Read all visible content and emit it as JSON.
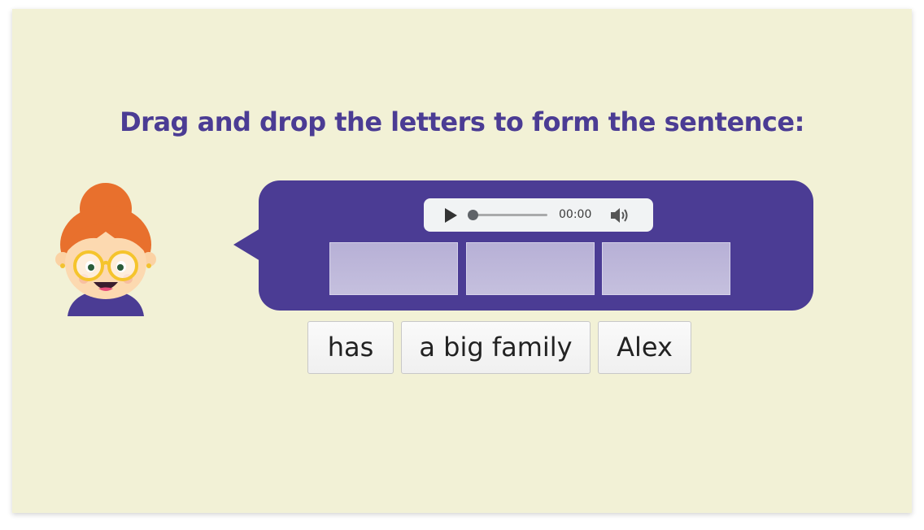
{
  "instruction": "Drag and drop the letters to form the sentence:",
  "audio": {
    "time": "00:00",
    "progress": 0
  },
  "answer_slots": 3,
  "word_tiles": [
    {
      "label": "has"
    },
    {
      "label": "a big family"
    },
    {
      "label": "Alex"
    }
  ],
  "icons": {
    "avatar": "girl-with-glasses-icon",
    "play": "play-icon",
    "volume": "volume-icon"
  },
  "colors": {
    "background": "#f2f1d6",
    "accent": "#4b3c94",
    "slot": "#bcb5d9",
    "tile": "#f5f5f5"
  }
}
